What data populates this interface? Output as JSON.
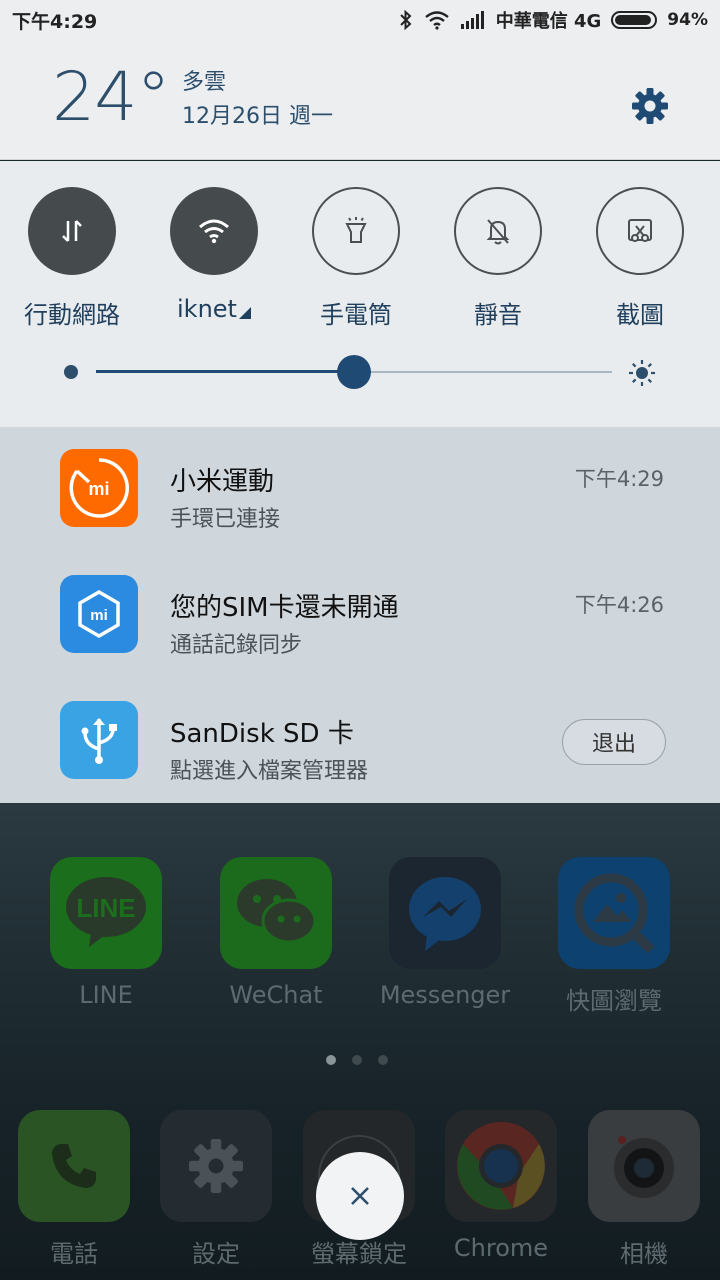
{
  "status_bar": {
    "time": "下午4:29",
    "carrier": "中華電信 4G",
    "battery_percent": "94%",
    "battery_level": 0.94,
    "icons": [
      "bluetooth-icon",
      "wifi-icon",
      "signal-icon",
      "battery-icon"
    ]
  },
  "weather": {
    "temperature": "24°",
    "condition": "多雲",
    "date": "12月26日 週一"
  },
  "quick_settings": {
    "toggles": [
      {
        "label": "行動網路",
        "state": "on",
        "icon": "mobile-data-icon"
      },
      {
        "label": "iknet",
        "state": "on",
        "icon": "wifi-icon"
      },
      {
        "label": "手電筒",
        "state": "off",
        "icon": "flashlight-icon"
      },
      {
        "label": "靜音",
        "state": "off",
        "icon": "mute-icon"
      },
      {
        "label": "截圖",
        "state": "off",
        "icon": "screenshot-icon"
      }
    ],
    "brightness_level": 0.5
  },
  "notifications": [
    {
      "title": "小米運動",
      "subtitle": "手環已連接",
      "time": "下午4:29",
      "icon": "mi-fit-icon",
      "color": "#ff6a00"
    },
    {
      "title": "您的SIM卡還未開通",
      "subtitle": "通話記錄同步",
      "time": "下午4:26",
      "icon": "mi-sim-icon",
      "color": "#2a8be0"
    },
    {
      "title": "SanDisk SD 卡",
      "subtitle": "點選進入檔案管理器",
      "action": "退出",
      "icon": "usb-icon",
      "color": "#3aa3e3"
    }
  ],
  "home_screen": {
    "row_apps": [
      {
        "name": "LINE",
        "icon": "line-icon",
        "color": "#1b7a1b"
      },
      {
        "name": "WeChat",
        "icon": "wechat-icon",
        "color": "#1c7a1c"
      },
      {
        "name": "Messenger",
        "icon": "messenger-icon",
        "color": "#1a2530"
      },
      {
        "name": "快圖瀏覽",
        "icon": "gallery-icon",
        "color": "#0f4d8c"
      }
    ],
    "dock_apps": [
      {
        "name": "電話",
        "icon": "phone-icon",
        "color": "#2d5a26"
      },
      {
        "name": "設定",
        "icon": "settings-icon",
        "color": "#262e33"
      },
      {
        "name": "螢幕鎖定",
        "icon": "lock-icon",
        "color": "#252a2d"
      },
      {
        "name": "Chrome",
        "icon": "chrome-icon",
        "color": "#262a2d"
      },
      {
        "name": "相機",
        "icon": "camera-icon",
        "color": "#3a3d40"
      }
    ],
    "page_count": 3,
    "active_page": 1
  },
  "colors": {
    "accent": "#1f4a73",
    "text_primary": "#2d4f6c"
  }
}
